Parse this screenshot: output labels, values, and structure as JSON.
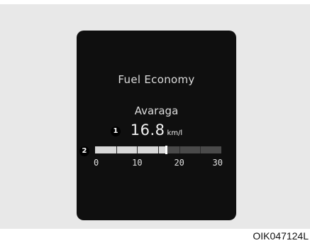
{
  "display": {
    "title": "Fuel Economy",
    "mode": "Avaraga",
    "value": "16.8",
    "unit": "km/l"
  },
  "markers": [
    "1",
    "2"
  ],
  "gauge": {
    "min": 0,
    "max": 30,
    "current": 16.8,
    "scale_labels": [
      "0",
      "10",
      "20",
      "30"
    ]
  },
  "caption": "OIK047124L"
}
